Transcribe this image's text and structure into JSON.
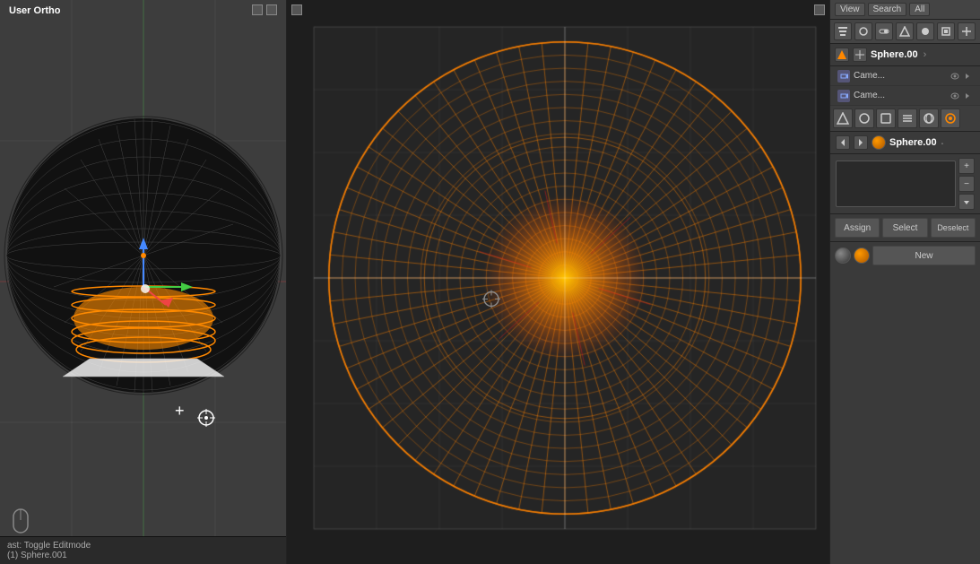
{
  "left_viewport": {
    "label": "User Ortho",
    "bottom_status": "ast: Toggle Editmode",
    "sphere_info": "(1) Sphere.001"
  },
  "right_panel": {
    "top_bar": {
      "view": "View",
      "search": "Search",
      "all": "All"
    },
    "scene": {
      "name": "Sphere.00",
      "arrow": "›"
    },
    "outliner": [
      {
        "label": "Came...",
        "has_eye": true,
        "has_arrow": true
      },
      {
        "label": "Came...",
        "has_eye": true,
        "has_arrow": true
      }
    ],
    "material": {
      "sphere_label": "Sphere.00",
      "assign_btn": "Assign",
      "select_btn": "Select",
      "deselect_btn": "Deselect",
      "new_btn": "New"
    }
  }
}
